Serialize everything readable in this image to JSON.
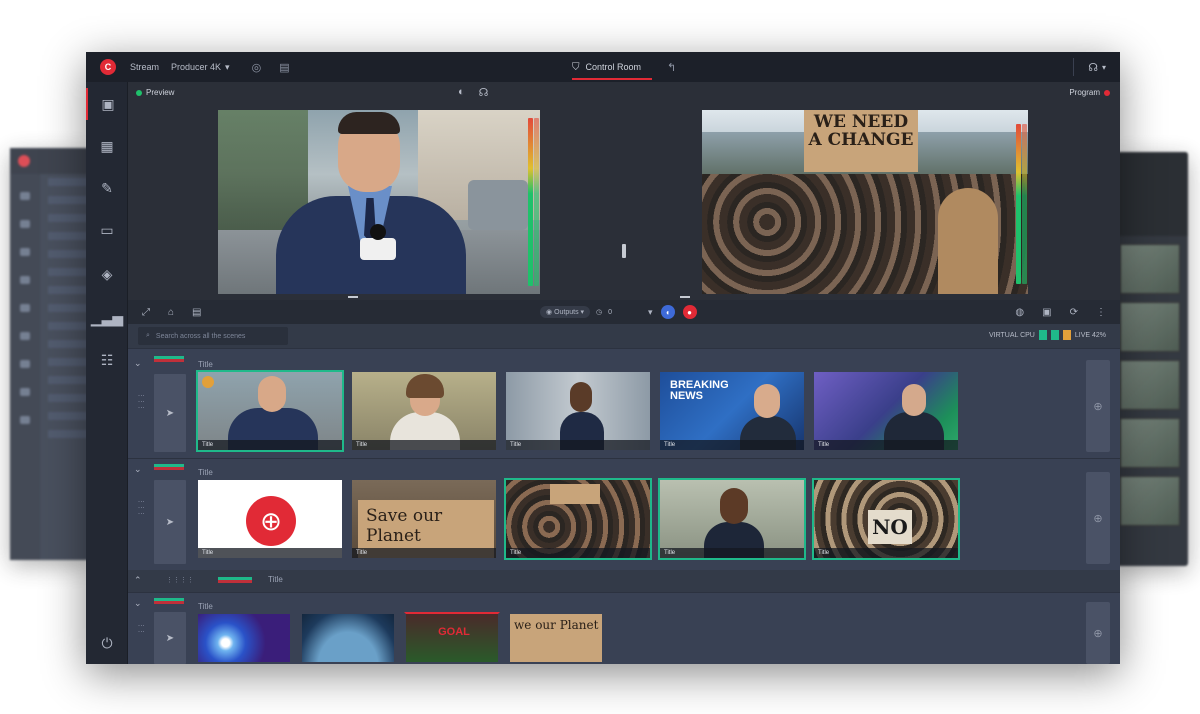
{
  "app": {
    "logo_glyph": "C",
    "workspace": "Stream",
    "account": "Producer 4K",
    "center_tab": "Control Room",
    "status_indicator_color": "#1fc16b"
  },
  "monitors": {
    "preview_label": "Preview",
    "program_label": "Program",
    "preview_dot_color": "#1fc16b",
    "program_dot_color": "#e12a36"
  },
  "controls": {
    "source_label": "Outputs",
    "counter_label": "0"
  },
  "search": {
    "placeholder": "Search across all the scenes"
  },
  "cpu": {
    "label": "VIRTUAL CPU",
    "value": "LIVE 42%"
  },
  "scene_groups": [
    {
      "title": "Title",
      "flag_color_top": "#1fb98a",
      "flag_color_bottom": "#c0303a",
      "thumbs": [
        {
          "name": "anchor-street",
          "caption": "Title",
          "live": true
        },
        {
          "name": "reporter-woman",
          "caption": "Title",
          "live": false
        },
        {
          "name": "speaker-podium",
          "caption": "Title",
          "live": false
        },
        {
          "name": "breaking-news",
          "caption": "Title",
          "live": false,
          "overlay": "BREAKING NEWS"
        },
        {
          "name": "studio-anchor",
          "caption": "Title",
          "live": false
        }
      ]
    },
    {
      "title": "Title",
      "flag_color_top": "#1fb98a",
      "flag_color_bottom": "#c0303a",
      "thumbs": [
        {
          "name": "globe-logo",
          "caption": "Title",
          "live": false
        },
        {
          "name": "save-our-planet-sign",
          "caption": "Title",
          "live": false,
          "overlay": "Save our Planet"
        },
        {
          "name": "protest-crowd",
          "caption": "Title",
          "live": true
        },
        {
          "name": "woman-reporter-mic",
          "caption": "Title",
          "live": true
        },
        {
          "name": "no-sign-crowd",
          "caption": "Title",
          "live": true,
          "overlay": "NO"
        }
      ]
    }
  ],
  "collapsed_row": {
    "title": "Title",
    "flag_color_top": "#1fb98a",
    "flag_color_bottom": "#c0303a"
  },
  "scene_groups_3": {
    "title": "Title",
    "thumbs": [
      {
        "name": "light-burst"
      },
      {
        "name": "earth-orbit"
      },
      {
        "name": "cheer-sign",
        "overlay": "GOAL"
      },
      {
        "name": "we-our-planet-sign",
        "overlay": "we our Planet"
      }
    ]
  },
  "preview_sign": {
    "line1": "WE NEED",
    "line2": "A CHANGE"
  }
}
